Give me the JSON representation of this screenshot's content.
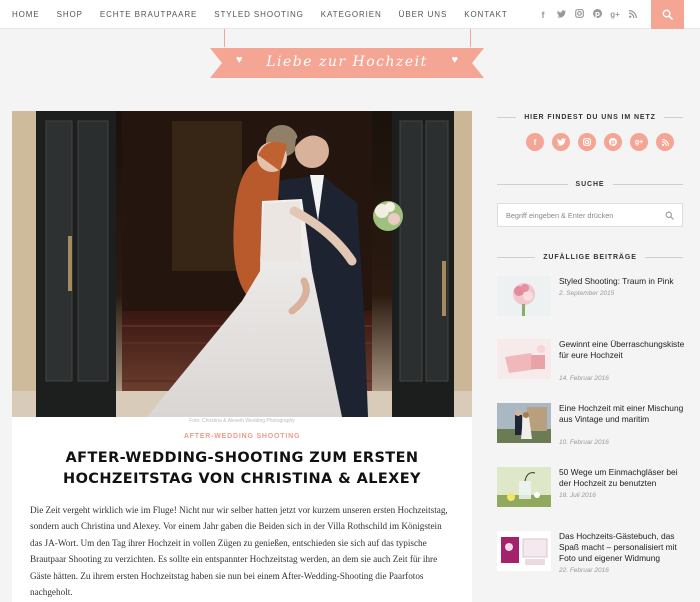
{
  "nav": {
    "items": [
      {
        "label": "HOME"
      },
      {
        "label": "SHOP"
      },
      {
        "label": "ECHTE BRAUTPAARE"
      },
      {
        "label": "STYLED SHOOTING"
      },
      {
        "label": "KATEGORIEN"
      },
      {
        "label": "ÜBER UNS"
      },
      {
        "label": "KONTAKT"
      }
    ],
    "social_icons": [
      "facebook-icon",
      "twitter-icon",
      "instagram-icon",
      "pinterest-icon",
      "googleplus-icon",
      "rss-icon"
    ],
    "search_icon": "search-icon"
  },
  "logo": {
    "text": "Liebe zur Hochzeit"
  },
  "post": {
    "photo_credit": "Foto: Christina & Alexeih Wedding Photography",
    "category": "AFTER-WEDDING SHOOTING",
    "title": "After-Wedding-Shooting zum ersten Hochzeitstag von Christina & Alexey",
    "body": "Die Zeit vergeht wirklich wie im Fluge! Nicht nur wir selber hatten jetzt vor kurzem unseren ersten Hochzeitstag, sondern auch Christina und Alexey. Vor einem Jahr gaben die Beiden sich in der Villa Rothschild im Königstein das JA-Wort. Um den Tag ihrer Hochzeit in vollen Zügen zu genießen, entschieden sie sich auf das typische Brautpaar Shooting zu verzichten. Es sollte ein entspannter Hochzeitstag werden, an dem sie auch Zeit für ihre Gäste hätten. Zu ihrem ersten Hochzeitstag haben sie nun bei einem After-Wedding-Shooting die Paarfotos nachgeholt."
  },
  "sidebar": {
    "social_heading": "HIER FINDEST DU UNS IM NETZ",
    "search_heading": "SUCHE",
    "search_placeholder": "Begriff eingeben & Enter drücken",
    "random_heading": "ZUFÄLLIGE BEITRÄGE",
    "posts": [
      {
        "title": "Styled Shooting: Traum in Pink",
        "date": "2. September 2015"
      },
      {
        "title": "Gewinnt eine Überraschungskiste für eure Hochzeit",
        "date": "14. Februar 2016"
      },
      {
        "title": "Eine Hochzeit mit einer Mischung aus Vintage und maritim",
        "date": "10. Februar 2016"
      },
      {
        "title": "50 Wege um Einmachgläser bei der Hochzeit zu benutzten",
        "date": "18. Juli 2016"
      },
      {
        "title": "Das Hochzeits-Gästebuch, das Spaß macht – personalisiert mit Foto und eigener Widmung",
        "date": "22. Februar 2016"
      }
    ]
  },
  "colors": {
    "accent": "#f4a594",
    "category": "#f09a87"
  }
}
